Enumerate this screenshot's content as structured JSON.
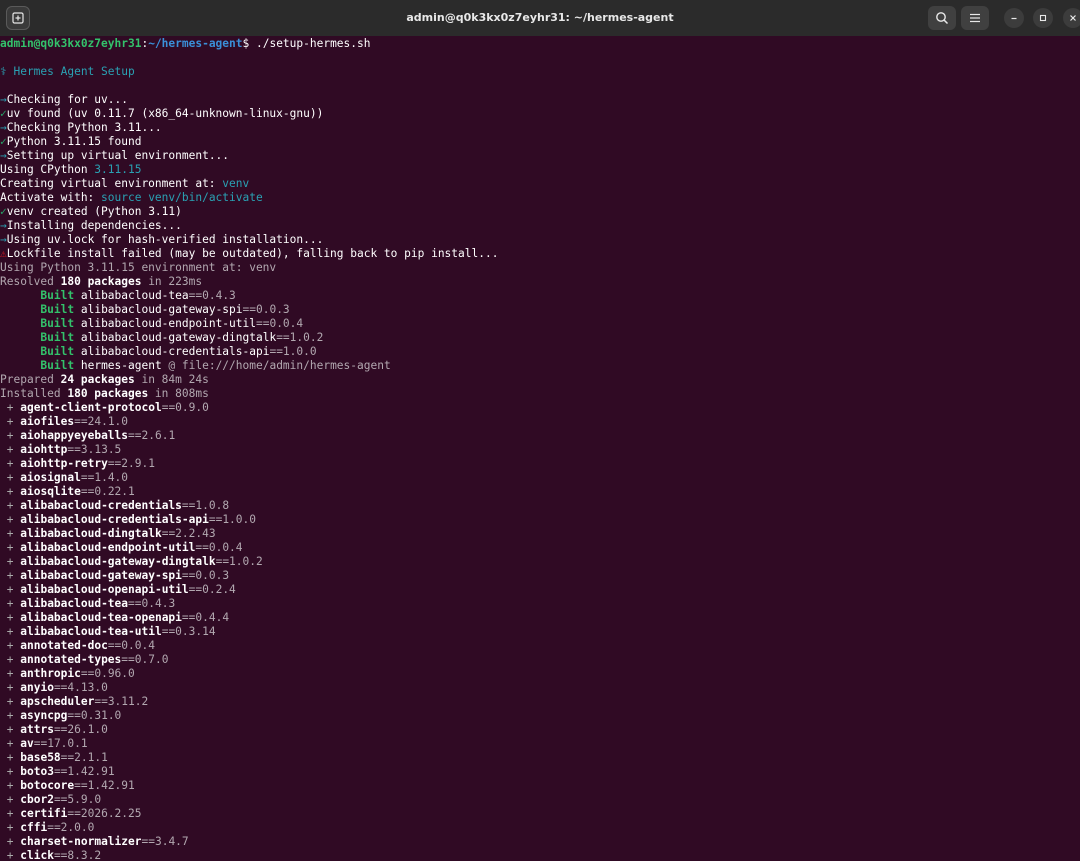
{
  "window": {
    "title": "admin@q0k3kx0z7eyhr31: ~/hermes-agent"
  },
  "prompt": {
    "user_host": "admin@q0k3kx0z7eyhr31",
    "colon": ":",
    "path": "~/hermes-agent",
    "dollar": "$ ",
    "command": "./setup-hermes.sh"
  },
  "setup": {
    "header": "⚕ Hermes Agent Setup",
    "arrow": "→",
    "check": "✓",
    "warn": "⚠",
    "checking_uv": "Checking for uv...",
    "uv_found": "uv found (uv 0.11.7 (x86_64-unknown-linux-gnu))",
    "checking_python": "Checking Python 3.11...",
    "python_found": "Python 3.11.15 found",
    "setting_venv": "Setting up virtual environment...",
    "using_cpython_label": "Using CPython ",
    "using_cpython_version": "3.11.15",
    "creating_venv_label": "Creating virtual environment at: ",
    "creating_venv_value": "venv",
    "activate_label": "Activate with: ",
    "activate_value": "source venv/bin/activate",
    "venv_created": "venv created (Python 3.11)",
    "installing_deps": "Installing dependencies...",
    "using_uvlock": "Using uv.lock for hash-verified installation...",
    "lockfile_failed": "Lockfile install failed (may be outdated), falling back to pip install...",
    "using_python_env": "Using Python 3.11.15 environment at: venv",
    "resolved_a": "Resolved ",
    "resolved_b": "180 packages",
    "resolved_c": " in 223ms",
    "prepared_a": "Prepared ",
    "prepared_b": "24 packages",
    "prepared_c": " in 84m 24s",
    "installed_a": "Installed ",
    "installed_b": "180 packages",
    "installed_c": " in 808ms"
  },
  "built_label": "Built",
  "built": [
    {
      "name": "alibabacloud-tea",
      "rest": "==0.4.3"
    },
    {
      "name": "alibabacloud-gateway-spi",
      "rest": "==0.0.3"
    },
    {
      "name": "alibabacloud-endpoint-util",
      "rest": "==0.0.4"
    },
    {
      "name": "alibabacloud-gateway-dingtalk",
      "rest": "==1.0.2"
    },
    {
      "name": "alibabacloud-credentials-api",
      "rest": "==1.0.0"
    },
    {
      "name": "hermes-agent",
      "rest": " @ file:///home/admin/hermes-agent"
    }
  ],
  "plus": "+",
  "installed_packages": [
    {
      "name": "agent-client-protocol",
      "version": "==0.9.0"
    },
    {
      "name": "aiofiles",
      "version": "==24.1.0"
    },
    {
      "name": "aiohappyeyeballs",
      "version": "==2.6.1"
    },
    {
      "name": "aiohttp",
      "version": "==3.13.5"
    },
    {
      "name": "aiohttp-retry",
      "version": "==2.9.1"
    },
    {
      "name": "aiosignal",
      "version": "==1.4.0"
    },
    {
      "name": "aiosqlite",
      "version": "==0.22.1"
    },
    {
      "name": "alibabacloud-credentials",
      "version": "==1.0.8"
    },
    {
      "name": "alibabacloud-credentials-api",
      "version": "==1.0.0"
    },
    {
      "name": "alibabacloud-dingtalk",
      "version": "==2.2.43"
    },
    {
      "name": "alibabacloud-endpoint-util",
      "version": "==0.0.4"
    },
    {
      "name": "alibabacloud-gateway-dingtalk",
      "version": "==1.0.2"
    },
    {
      "name": "alibabacloud-gateway-spi",
      "version": "==0.0.3"
    },
    {
      "name": "alibabacloud-openapi-util",
      "version": "==0.2.4"
    },
    {
      "name": "alibabacloud-tea",
      "version": "==0.4.3"
    },
    {
      "name": "alibabacloud-tea-openapi",
      "version": "==0.4.4"
    },
    {
      "name": "alibabacloud-tea-util",
      "version": "==0.3.14"
    },
    {
      "name": "annotated-doc",
      "version": "==0.0.4"
    },
    {
      "name": "annotated-types",
      "version": "==0.7.0"
    },
    {
      "name": "anthropic",
      "version": "==0.96.0"
    },
    {
      "name": "anyio",
      "version": "==4.13.0"
    },
    {
      "name": "apscheduler",
      "version": "==3.11.2"
    },
    {
      "name": "asyncpg",
      "version": "==0.31.0"
    },
    {
      "name": "attrs",
      "version": "==26.1.0"
    },
    {
      "name": "av",
      "version": "==17.0.1"
    },
    {
      "name": "base58",
      "version": "==2.1.1"
    },
    {
      "name": "boto3",
      "version": "==1.42.91"
    },
    {
      "name": "botocore",
      "version": "==1.42.91"
    },
    {
      "name": "cbor2",
      "version": "==5.9.0"
    },
    {
      "name": "certifi",
      "version": "==2026.2.25"
    },
    {
      "name": "cffi",
      "version": "==2.0.0"
    },
    {
      "name": "charset-normalizer",
      "version": "==3.4.7"
    },
    {
      "name": "click",
      "version": "==8.3.2"
    }
  ],
  "icons": {
    "new_tab": "new-tab-icon",
    "search": "search-icon",
    "menu": "hamburger-menu-icon",
    "minimize": "minimize-icon",
    "maximize": "maximize-icon",
    "close": "close-icon"
  },
  "colors": {
    "background": "#300a24",
    "titlebar": "#2b2b2b",
    "green": "#26a269",
    "blue": "#3a8fd8",
    "cyan": "#2aa1b3",
    "red": "#e01b24"
  }
}
